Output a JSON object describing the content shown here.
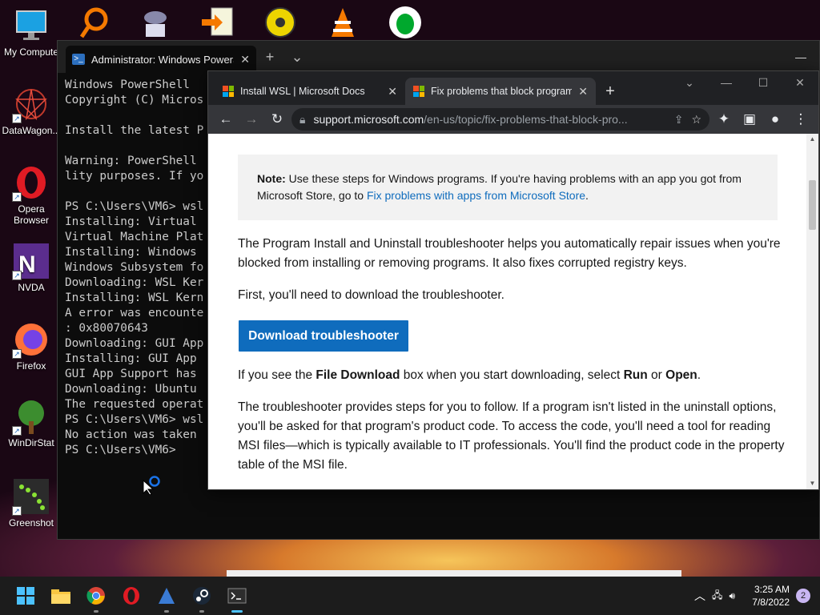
{
  "desktop_icons": [
    {
      "label": "My Compute",
      "icon": "monitor-icon"
    },
    {
      "label": "DataWagon...",
      "icon": "datawagon-icon"
    },
    {
      "label": "Opera Browser",
      "icon": "opera-icon"
    },
    {
      "label": "NVDA",
      "icon": "nvda-icon"
    },
    {
      "label": "Firefox",
      "icon": "firefox-icon"
    },
    {
      "label": "WinDirStat",
      "icon": "windirstat-icon"
    },
    {
      "label": "Greenshot",
      "icon": "greenshot-icon"
    }
  ],
  "terminal": {
    "tab_title": "Administrator: Windows PowerS",
    "lines": [
      "Windows PowerShell",
      "Copyright (C) Micros",
      "",
      "Install the latest P",
      "",
      "Warning: PowerShell ",
      "lity purposes. If yo",
      "",
      "PS C:\\Users\\VM6> wsl",
      "Installing: Virtual ",
      "Virtual Machine Plat",
      "Installing: Windows ",
      "Windows Subsystem fo",
      "Downloading: WSL Ker",
      "Installing: WSL Kern",
      "A error was encounte",
      ": 0x80070643",
      "Downloading: GUI App",
      "Installing: GUI App ",
      "GUI App Support has ",
      "Downloading: Ubuntu ",
      "The requested operat",
      "PS C:\\Users\\VM6> wsl",
      "No action was taken ",
      "PS C:\\Users\\VM6>"
    ]
  },
  "browser": {
    "tabs": [
      {
        "title": "Install WSL | Microsoft Docs",
        "active": false
      },
      {
        "title": "Fix problems that block program",
        "active": true
      }
    ],
    "url_host": "support.microsoft.com",
    "url_path": "/en-us/topic/fix-problems-that-block-pro...",
    "note": {
      "label": "Note:",
      "text": " Use these steps for Windows programs. If you're having problems with an app you got from Microsoft Store, go to ",
      "link": "Fix problems with apps from Microsoft Store",
      "end": "."
    },
    "para1": "The Program Install and Uninstall troubleshooter helps you automatically repair issues when you're blocked from installing or removing programs. It also fixes corrupted registry keys.",
    "para2": "First, you'll need to download the troubleshooter.",
    "download_button": "Download troubleshooter",
    "para3": {
      "a": "If you see the ",
      "b": "File Download",
      "c": " box when you start downloading, select ",
      "d": "Run",
      "e": " or ",
      "f": "Open",
      "g": "."
    },
    "para4": "The troubleshooter provides steps for you to follow. If a program isn't listed in the uninstall options, you'll be asked for that program's product code. To access the code, you'll need a tool for reading MSI files—which is typically available to IT professionals. You'll find the product code in the property table of the MSI file."
  },
  "taskbar": {
    "time": "3:25 AM",
    "date": "7/8/2022",
    "notifications": "2"
  },
  "colors": {
    "accent": "#0f6cbd",
    "chrome_dark": "#202124",
    "terminal_bg": "#0c0c0c"
  }
}
